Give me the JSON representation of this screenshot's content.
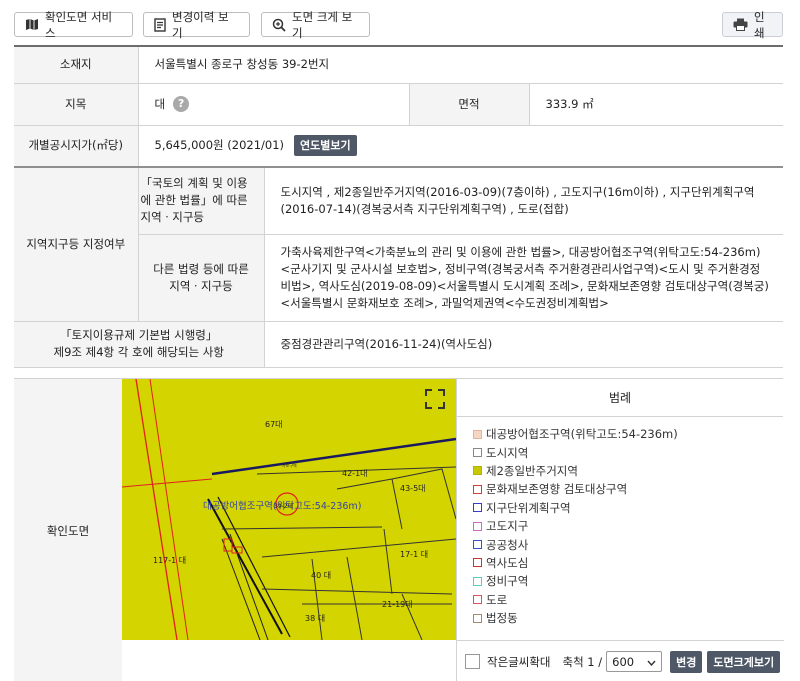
{
  "toolbar": {
    "confirm_service": "확인도면 서비스",
    "history": "변경이력 보기",
    "enlarge": "도면 크게 보기",
    "print": "인쇄"
  },
  "info": {
    "location_label": "소재지",
    "location_value": "서울특별시 종로구 창성동 39-2번지",
    "jimok_label": "지목",
    "jimok_value": "대",
    "help_mark": "?",
    "area_label": "면적",
    "area_value": "333.9 ㎡",
    "price_label": "개별공시지가(㎡당)",
    "price_value": "5,645,000원 (2021/01)",
    "price_button": "연도별보기",
    "zone_label": "지역지구등 지정여부",
    "zone_sub1_label": "「국토의 계획 및 이용에 관한 법률」에 따른 지역ㆍ지구등",
    "zone_sub1_value": "도시지역 , 제2종일반주거지역(2016-03-09)(7층이하) , 고도지구(16m이하) , 지구단위계획구역(2016-07-14)(경복궁서측 지구단위계획구역) , 도로(접합)",
    "zone_sub2_label": "다른 법령 등에 따른 지역ㆍ지구등",
    "zone_sub2_value": "가축사육제한구역<가축분뇨의 관리 및 이용에 관한 법률>, 대공방어협조구역(위탁고도:54-236m)<군사기지 및 군사시설 보호법>, 정비구역(경복궁서측 주거환경관리사업구역)<도시 및 주거환경정비법>, 역사도심(2019-08-09)<서울특별시 도시계획 조례>, 문화재보존영향 검토대상구역(경복궁)<서울특별시 문화재보호 조례>, 과밀억제권역<수도권정비계획법>",
    "reg_label_line1": "「토지이용규제 기본법 시행령」",
    "reg_label_line2": "제9조 제4항 각 호에 해당되는 사항",
    "reg_value": "중점경관관리구역(2016-11-24)(역사도심)"
  },
  "map": {
    "label": "확인도면",
    "parcels": {
      "p67": "67대",
      "p42_1": "42-1대",
      "p43_5": "43-5대",
      "p17_1": "17-1 대",
      "p40": "40 대",
      "p117_1": "117-1 대",
      "p21_19": "21-19대",
      "p38": "38 대"
    },
    "overlay_text": "대공방어협조구역(위탁고도:54-236m)",
    "center_label": "39-2대",
    "tiny_label": "가로구역"
  },
  "legend": {
    "title": "범례",
    "items": [
      {
        "label": "대공방어협조구역(위탁고도:54-236m)",
        "color": "#f6d7c6"
      },
      {
        "label": "도시지역",
        "color": "#ffffff"
      },
      {
        "label": "제2종일반주거지역",
        "color": "#c8c800"
      },
      {
        "label": "문화재보존영향 검토대상구역",
        "color": "#ffffff"
      },
      {
        "label": "지구단위계획구역",
        "color": "#ffffff"
      },
      {
        "label": "고도지구",
        "color": "#ffffff"
      },
      {
        "label": "공공청사",
        "color": "#ffffff"
      },
      {
        "label": "역사도심",
        "color": "#ffffff"
      },
      {
        "label": "정비구역",
        "color": "#ffffff"
      },
      {
        "label": "도로",
        "color": "#ffffff"
      },
      {
        "label": "법정동",
        "color": "#ffffff"
      }
    ],
    "border_colors": [
      "#e3b49a",
      "#888888",
      "#b3b300",
      "#d93a3a",
      "#3a3acb",
      "#cc66cc",
      "#3355cc",
      "#cc3333",
      "#55cccc",
      "#d95555",
      "#aa8866"
    ]
  },
  "controls": {
    "small_text": "작은글씨확대",
    "scale_label": "축척 1 /",
    "scale_value": "600",
    "change_button": "변경",
    "bigmap_button": "도면크게보기"
  }
}
